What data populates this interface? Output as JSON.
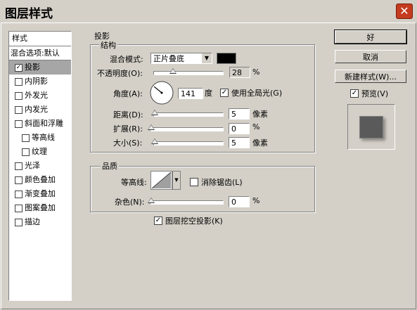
{
  "window": {
    "title": "图层样式",
    "close_icon": "close-icon"
  },
  "styles_panel": {
    "header": "样式",
    "blend_options": "混合选项:默认",
    "items": [
      {
        "label": "投影",
        "checked": true,
        "selected": true
      },
      {
        "label": "内阴影",
        "checked": false
      },
      {
        "label": "外发光",
        "checked": false
      },
      {
        "label": "内发光",
        "checked": false
      },
      {
        "label": "斜面和浮雕",
        "checked": false
      },
      {
        "label": "等高线",
        "checked": false,
        "indent": true
      },
      {
        "label": "纹理",
        "checked": false,
        "indent": true
      },
      {
        "label": "光泽",
        "checked": false
      },
      {
        "label": "颜色叠加",
        "checked": false
      },
      {
        "label": "渐变叠加",
        "checked": false
      },
      {
        "label": "图案叠加",
        "checked": false
      },
      {
        "label": "描边",
        "checked": false
      }
    ]
  },
  "drop_shadow": {
    "title": "投影",
    "structure": {
      "title": "结构",
      "blend_mode_label": "混合模式:",
      "blend_mode_value": "正片叠底",
      "color": "#000000",
      "opacity_label": "不透明度(O):",
      "opacity_value": "28",
      "opacity_unit": "%",
      "opacity_fraction": 0.28,
      "angle_label": "角度(A):",
      "angle_value": "141",
      "angle_unit": "度",
      "global_light_label": "使用全局光(G)",
      "global_light_checked": true,
      "distance_label": "距离(D):",
      "distance_value": "5",
      "distance_unit": "像素",
      "spread_label": "扩展(R):",
      "spread_value": "0",
      "spread_unit": "%",
      "size_label": "大小(S):",
      "size_value": "5",
      "size_unit": "像素"
    },
    "quality": {
      "title": "品质",
      "contour_label": "等高线:",
      "anti_alias_label": "消除锯齿(L)",
      "anti_alias_checked": false,
      "noise_label": "杂色(N):",
      "noise_value": "0",
      "noise_unit": "%"
    },
    "knockout_label": "图层挖空投影(K)",
    "knockout_checked": true
  },
  "buttons": {
    "ok": "好",
    "cancel": "取消",
    "new_style": "新建样式(W)...",
    "preview_label": "预览(V)",
    "preview_checked": true
  }
}
